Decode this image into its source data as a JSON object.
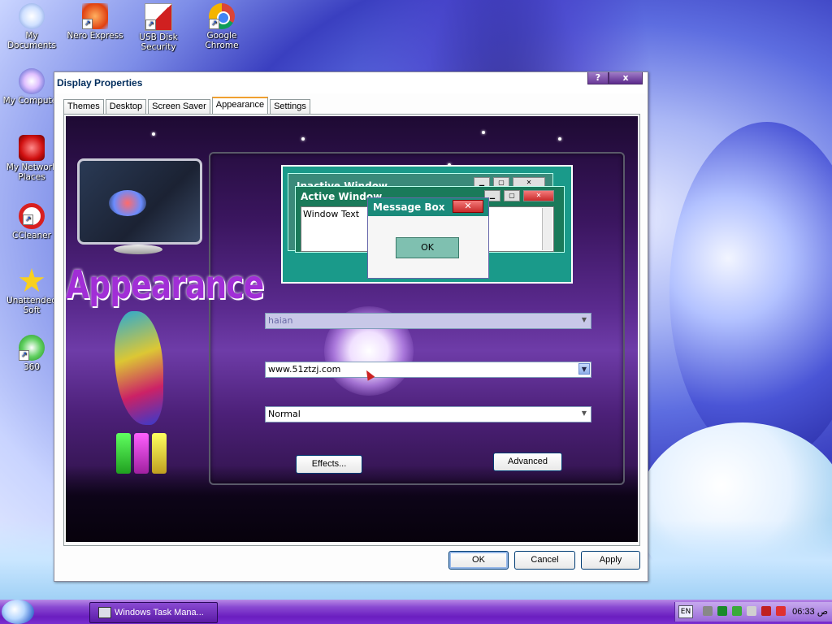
{
  "desktop": {
    "icons": [
      {
        "label": "My Documents",
        "icon": "my-documents-icon"
      },
      {
        "label": "Nero Express",
        "icon": "nero-express-icon"
      },
      {
        "label": "USB Disk Security",
        "icon": "usb-disk-security-icon"
      },
      {
        "label": "Google Chrome",
        "icon": "google-chrome-icon"
      },
      {
        "label": "My Computer",
        "icon": "my-computer-icon"
      },
      {
        "label": "My Network Places",
        "icon": "my-network-places-icon"
      },
      {
        "label": "CCleaner",
        "icon": "ccleaner-icon"
      },
      {
        "label": "Unattended Soft",
        "icon": "unattended-soft-icon"
      },
      {
        "label": "360",
        "icon": "360-icon"
      }
    ]
  },
  "dialog": {
    "title": "Display Properties",
    "help_btn": "?",
    "close_btn": "x",
    "tabs": [
      {
        "label": "Themes",
        "active": false
      },
      {
        "label": "Desktop",
        "active": false
      },
      {
        "label": "Screen Saver",
        "active": false
      },
      {
        "label": "Appearance",
        "active": true
      },
      {
        "label": "Settings",
        "active": false
      }
    ],
    "skin_logo": "Appearance",
    "preview": {
      "inactive_title": "Inactive Window",
      "active_title": "Active Window",
      "window_text": "Window Text",
      "message_box_title": "Message Box",
      "message_box_ok": "OK"
    },
    "combos": {
      "windows_and_buttons": "haian",
      "color_scheme": "www.51ztzj.com",
      "font_size": "Normal"
    },
    "buttons": {
      "effects": "Effects...",
      "advanced": "Advanced",
      "ok": "OK",
      "cancel": "Cancel",
      "apply": "Apply"
    }
  },
  "taskbar": {
    "task_label": "Windows Task Mana...",
    "lang": "EN",
    "clock": "06:33 ص"
  },
  "colors": {
    "title_text": "#002c5c",
    "taskbar": "#6a1ec0",
    "logo": "#a12ed6"
  }
}
